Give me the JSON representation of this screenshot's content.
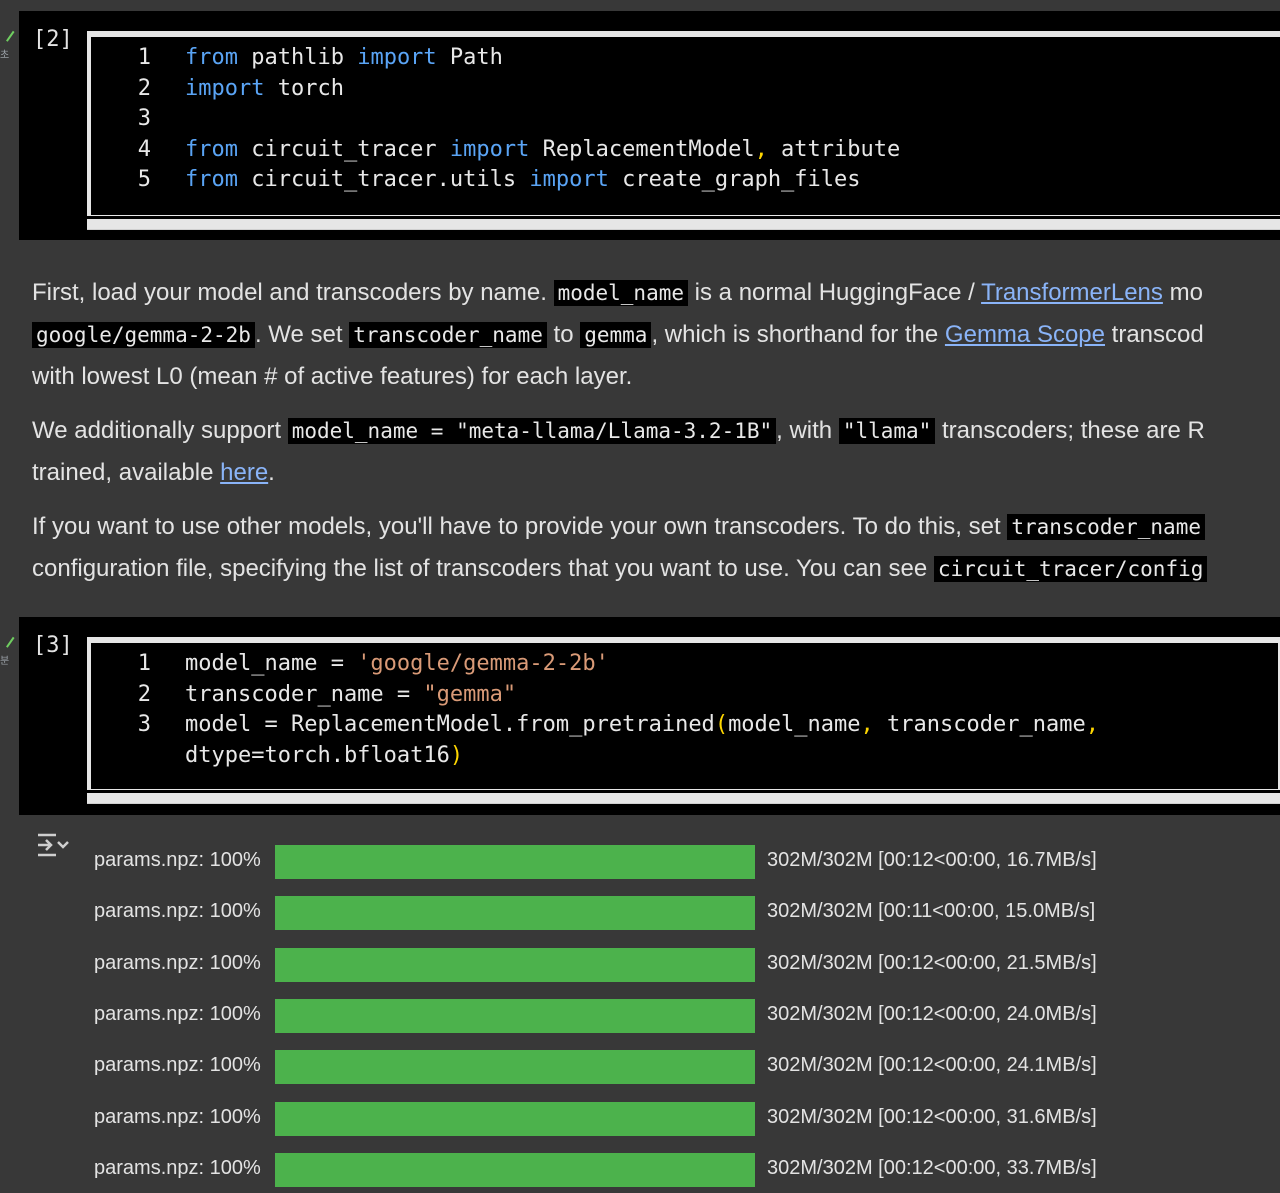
{
  "cell1": {
    "status": "초",
    "exec_count": "[2]",
    "lines": [
      {
        "n": "1",
        "parts": [
          {
            "t": "from",
            "c": "kw"
          },
          {
            "t": " pathlib ",
            "c": ""
          },
          {
            "t": "import",
            "c": "kw"
          },
          {
            "t": " Path",
            "c": ""
          }
        ]
      },
      {
        "n": "2",
        "parts": [
          {
            "t": "import",
            "c": "kw"
          },
          {
            "t": " torch",
            "c": ""
          }
        ]
      },
      {
        "n": "3",
        "parts": []
      },
      {
        "n": "4",
        "parts": [
          {
            "t": "from",
            "c": "kw"
          },
          {
            "t": " circuit_tracer ",
            "c": ""
          },
          {
            "t": "import",
            "c": "kw"
          },
          {
            "t": " ReplacementModel",
            "c": ""
          },
          {
            "t": ",",
            "c": "comma"
          },
          {
            "t": " attribute",
            "c": ""
          }
        ]
      },
      {
        "n": "5",
        "parts": [
          {
            "t": "from",
            "c": "kw"
          },
          {
            "t": " circuit_tracer.utils ",
            "c": ""
          },
          {
            "t": "import",
            "c": "kw"
          },
          {
            "t": " create_graph_files",
            "c": ""
          }
        ]
      }
    ]
  },
  "markdown": {
    "p1a": "First, load your model and transcoders by name. ",
    "p1b_code": "model_name",
    "p1c": " is a normal HuggingFace / ",
    "p1d_link": "TransformerLens",
    "p1e": " mo",
    "p2a_code": "google/gemma-2-2b",
    "p2b": ". We set ",
    "p2c_code": "transcoder_name",
    "p2d": " to ",
    "p2e_code": "gemma",
    "p2f": ", which is shorthand for the ",
    "p2g_link": "Gemma Scope",
    "p2h": " transcod",
    "p3": "with lowest L0 (mean # of active features) for each layer.",
    "p4a": "We additionally support ",
    "p4b_code": "model_name = \"meta-llama/Llama-3.2-1B\"",
    "p4c": ", with ",
    "p4d_code": "\"llama\"",
    "p4e": " transcoders; these are R",
    "p5a": "trained, available ",
    "p5b_link": "here",
    "p5c": ".",
    "p6a": "If you want to use other models, you'll have to provide your own transcoders. To do this, set ",
    "p6b_code": "transcoder_name",
    "p7a": "configuration file, specifying the list of transcoders that you want to use. You can see ",
    "p7b_code": "circuit_tracer/config"
  },
  "cell2": {
    "status": "분",
    "exec_count": "[3]",
    "lines": [
      {
        "n": "1",
        "parts": [
          {
            "t": "model_name = ",
            "c": ""
          },
          {
            "t": "'google/gemma-2-2b'",
            "c": "str"
          }
        ]
      },
      {
        "n": "2",
        "parts": [
          {
            "t": "transcoder_name = ",
            "c": ""
          },
          {
            "t": "\"gemma\"",
            "c": "str"
          }
        ]
      },
      {
        "n": "3",
        "parts": [
          {
            "t": "model = ReplacementModel.from_pretrained",
            "c": ""
          },
          {
            "t": "(",
            "c": "par"
          },
          {
            "t": "model_name",
            "c": ""
          },
          {
            "t": ",",
            "c": "comma"
          },
          {
            "t": " transcoder_name",
            "c": ""
          },
          {
            "t": ",",
            "c": "comma"
          }
        ]
      },
      {
        "n": "",
        "parts": [
          {
            "t": "dtype=torch.bfloat16",
            "c": ""
          },
          {
            "t": ")",
            "c": "par"
          }
        ]
      }
    ]
  },
  "output": {
    "rows": [
      {
        "label": "params.npz: 100%",
        "progress": 1.0,
        "stats": "302M/302M [00:12<00:00, 16.7MB/s]"
      },
      {
        "label": "params.npz: 100%",
        "progress": 1.0,
        "stats": "302M/302M [00:11<00:00, 15.0MB/s]"
      },
      {
        "label": "params.npz: 100%",
        "progress": 1.0,
        "stats": "302M/302M [00:12<00:00, 21.5MB/s]"
      },
      {
        "label": "params.npz: 100%",
        "progress": 1.0,
        "stats": "302M/302M [00:12<00:00, 24.0MB/s]"
      },
      {
        "label": "params.npz: 100%",
        "progress": 1.0,
        "stats": "302M/302M [00:12<00:00, 24.1MB/s]"
      },
      {
        "label": "params.npz: 100%",
        "progress": 1.0,
        "stats": "302M/302M [00:12<00:00, 31.6MB/s]"
      },
      {
        "label": "params.npz: 100%",
        "progress": 1.0,
        "stats": "302M/302M [00:12<00:00, 33.7MB/s]"
      }
    ]
  }
}
